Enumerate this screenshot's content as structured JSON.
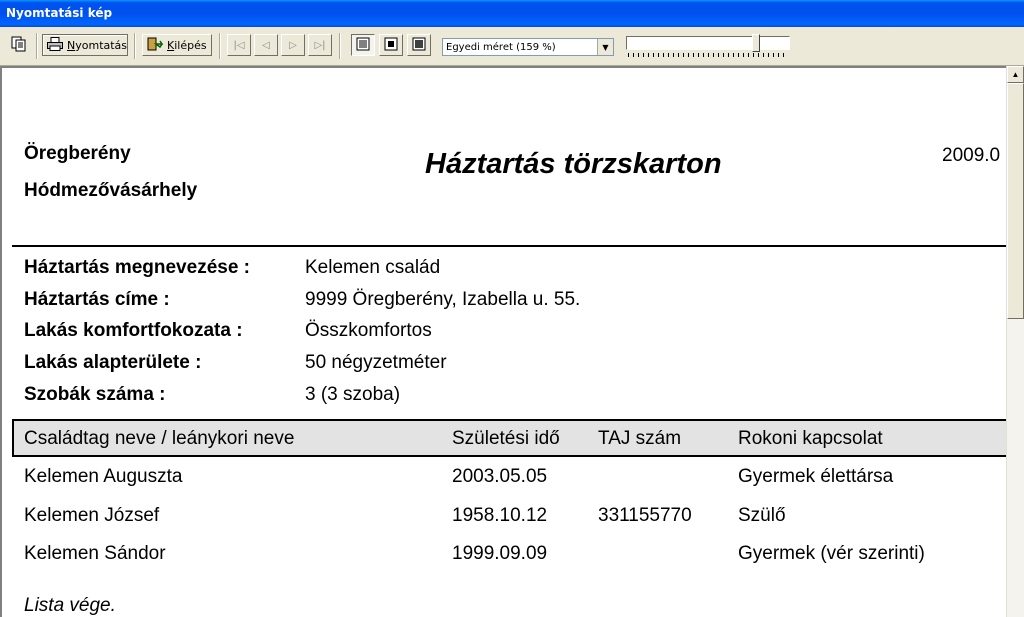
{
  "window": {
    "title": "Nyomtatási kép"
  },
  "toolbar": {
    "print_label_u": "N",
    "print_label_rest": "yomtatás",
    "exit_label_u": "K",
    "exit_label_rest": "ilépés",
    "first_icon": "|◁",
    "prev_icon": "◁",
    "next_icon": "▷",
    "last_icon": "▷|",
    "zoom_value": "Egyedi méret (159 %)"
  },
  "document": {
    "org_line1": "Öregberény",
    "org_line2": "Hódmezővásárhely",
    "title": "Háztartás törzskarton",
    "date": "2009.0",
    "fields": [
      {
        "label": "Háztartás megnevezése :",
        "value": "Kelemen család"
      },
      {
        "label": "Háztartás címe :",
        "value": "9999 Öregberény, Izabella u. 55."
      },
      {
        "label": "Lakás komfortfokozata :",
        "value": "Összkomfortos"
      },
      {
        "label": "Lakás alapterülete :",
        "value": "50 négyzetméter"
      },
      {
        "label": "Szobák száma :",
        "value": "3 (3 szoba)"
      }
    ],
    "table": {
      "headers": [
        "Családtag neve / leánykori neve",
        "Születési idő",
        "TAJ szám",
        "Rokoni kapcsolat"
      ],
      "rows": [
        [
          "Kelemen Auguszta",
          "2003.05.05",
          "",
          "Gyermek élettársa"
        ],
        [
          "Kelemen József",
          "1958.10.12",
          "331155770",
          "Szülő"
        ],
        [
          "Kelemen Sándor",
          "1999.09.09",
          "",
          "Gyermek (vér szerinti)"
        ]
      ]
    },
    "footer": "Lista vége."
  }
}
